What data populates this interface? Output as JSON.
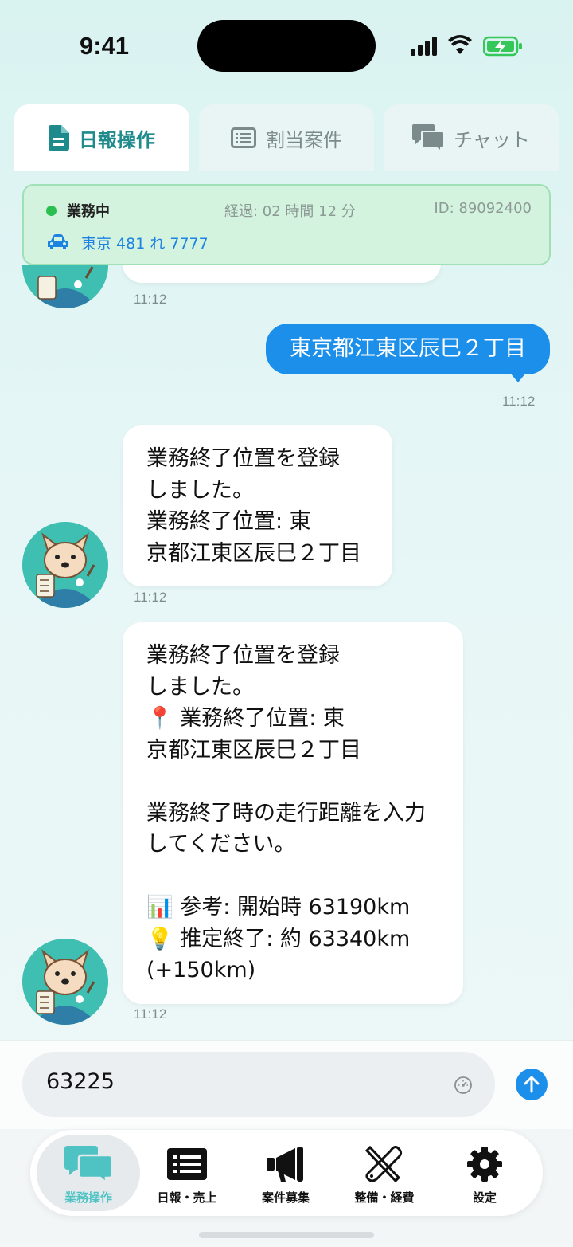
{
  "status_bar": {
    "time": "9:41"
  },
  "tabs": [
    {
      "label": "日報操作",
      "active": true,
      "icon": "document-icon"
    },
    {
      "label": "割当案件",
      "active": false,
      "icon": "list-icon"
    },
    {
      "label": "チャット",
      "active": false,
      "icon": "chat-icon"
    }
  ],
  "info": {
    "status": "業務中",
    "elapsed": "経過: 02 時間 12 分",
    "id": "ID: 89092400",
    "plate": "東京 481 れ 7777",
    "status_color": "#2bbf4f"
  },
  "messages": [
    {
      "from": "bot",
      "text": "",
      "time": "11:12"
    },
    {
      "from": "user",
      "text": "東京都江東区辰巳２丁目",
      "time": "11:12"
    },
    {
      "from": "bot",
      "text": "業務終了位置を登録\nしました。\n業務終了位置: 東\n京都江東区辰巳２丁目",
      "time": "11:12"
    },
    {
      "from": "bot",
      "text": "業務終了位置を登録\nしました。\n📍 業務終了位置: 東\n京都江東区辰巳２丁目\n\n業務終了時の走行距離を入力\nしてください。\n\n📊 参考: 開始時 63190km\n💡 推定終了: 約 63340km\n(+150km)",
      "time": "11:12"
    }
  ],
  "input": {
    "value": "63225"
  },
  "nav": [
    {
      "label": "業務操作",
      "active": true,
      "icon": "chat-bubbles-icon"
    },
    {
      "label": "日報・売上",
      "active": false,
      "icon": "list-icon"
    },
    {
      "label": "案件募集",
      "active": false,
      "icon": "megaphone-icon"
    },
    {
      "label": "整備・経費",
      "active": false,
      "icon": "tools-icon"
    },
    {
      "label": "設定",
      "active": false,
      "icon": "gear-icon"
    }
  ],
  "colors": {
    "accent": "#1c8fea",
    "teal": "#1f8a8c",
    "avatar_bg": "#3fbfb2"
  }
}
